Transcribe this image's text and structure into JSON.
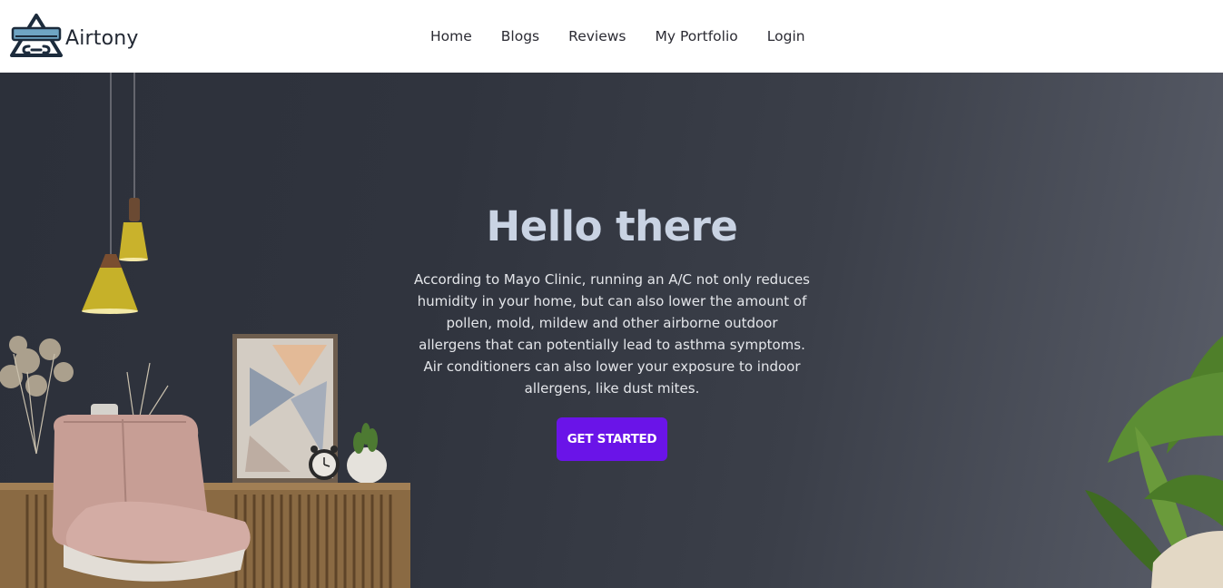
{
  "brand": {
    "name": "Airtony",
    "logo_icon": "air-conditioner-triangle-logo"
  },
  "nav": {
    "items": [
      {
        "label": "Home"
      },
      {
        "label": "Blogs"
      },
      {
        "label": "Reviews"
      },
      {
        "label": "My Portfolio"
      },
      {
        "label": "Login"
      }
    ]
  },
  "hero": {
    "title": "Hello there",
    "text": "According to Mayo Clinic, running an A/C not only reduces humidity in your home, but can also lower the amount of pollen, mold, mildew and other airborne outdoor allergens that can potentially lead to asthma symptoms. Air conditioners can also lower your exposure to indoor allergens, like dust mites.",
    "cta_label": "GET STARTED"
  },
  "colors": {
    "accent": "#6a14e8",
    "title": "#c9d3e3",
    "hero_background": "#30343e"
  }
}
